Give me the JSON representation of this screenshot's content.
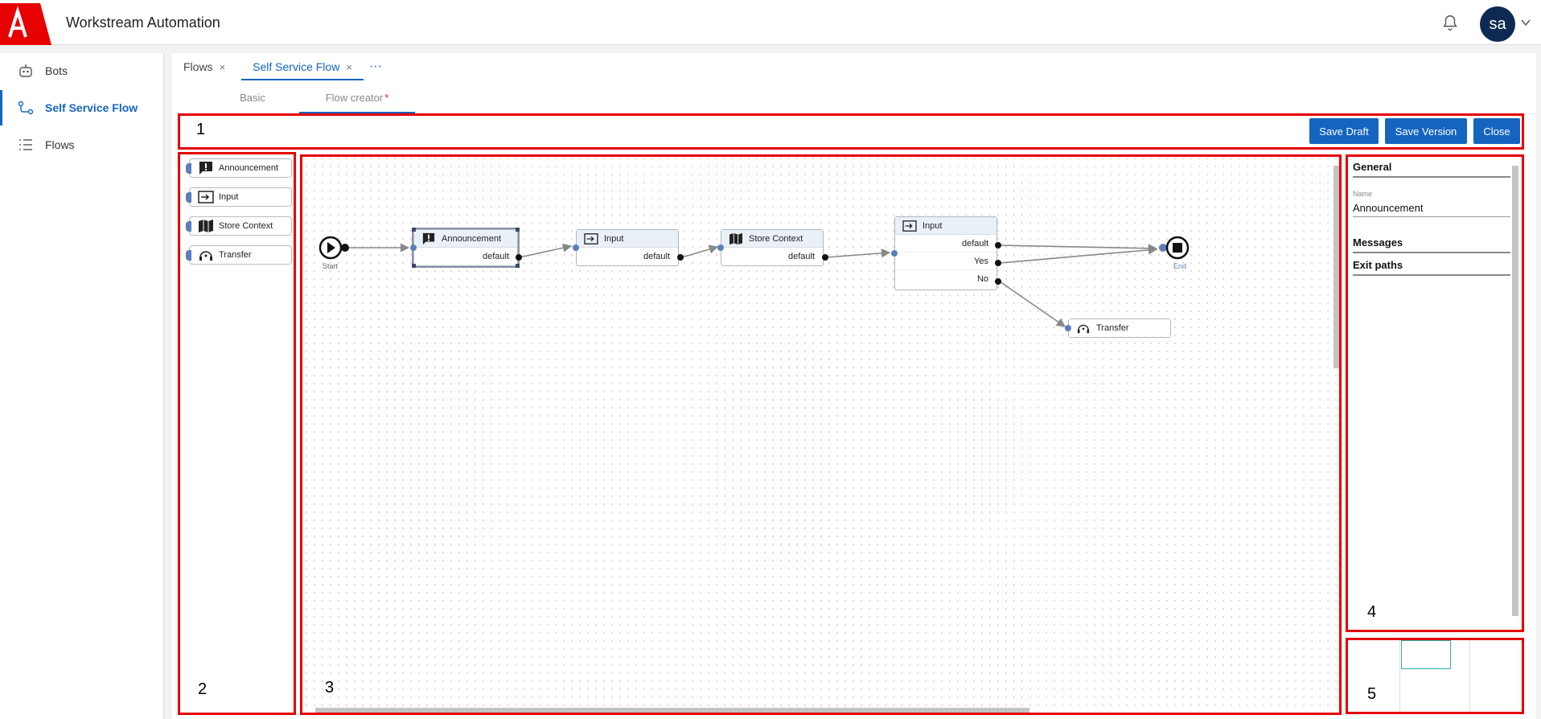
{
  "header": {
    "title": "Workstream Automation",
    "avatar_initials": "sa",
    "brand_color": "#e60000"
  },
  "sidebar": {
    "items": [
      {
        "label": "Bots",
        "icon": "robot-icon"
      },
      {
        "label": "Self Service Flow",
        "icon": "flow-icon",
        "active": true
      },
      {
        "label": "Flows",
        "icon": "list-icon"
      }
    ]
  },
  "tabs": [
    {
      "label": "Flows",
      "close": "×"
    },
    {
      "label": "Self Service Flow",
      "close": "×",
      "active": true
    }
  ],
  "tabs_more": "···",
  "subtabs": {
    "basic": "Basic",
    "flow_creator": "Flow creator",
    "required_mark": "*"
  },
  "toolbar": {
    "save_draft": "Save Draft",
    "save_version": "Save Version",
    "close": "Close"
  },
  "regions": {
    "r1": "1",
    "r2": "2",
    "r3": "3",
    "r4": "4",
    "r5": "5"
  },
  "palette": [
    {
      "label": "Announcement",
      "icon": "announcement-icon"
    },
    {
      "label": "Input",
      "icon": "input-icon"
    },
    {
      "label": "Store Context",
      "icon": "map-icon"
    },
    {
      "label": "Transfer",
      "icon": "transfer-icon"
    }
  ],
  "canvas": {
    "start_label": "Start",
    "end_label": "End",
    "nodes": {
      "announcement": {
        "title": "Announcement",
        "exits": [
          "default"
        ]
      },
      "input1": {
        "title": "Input",
        "exits": [
          "default"
        ]
      },
      "store": {
        "title": "Store Context",
        "exits": [
          "default"
        ]
      },
      "input2": {
        "title": "Input",
        "exits": [
          "default",
          "Yes",
          "No"
        ]
      },
      "transfer": {
        "title": "Transfer"
      }
    }
  },
  "properties": {
    "general": "General",
    "name_label": "Name",
    "name_value": "Announcement",
    "messages": "Messages",
    "exit_paths": "Exit paths"
  },
  "colors": {
    "primary_button": "#1565c0",
    "highlight_box": "#e60000"
  }
}
